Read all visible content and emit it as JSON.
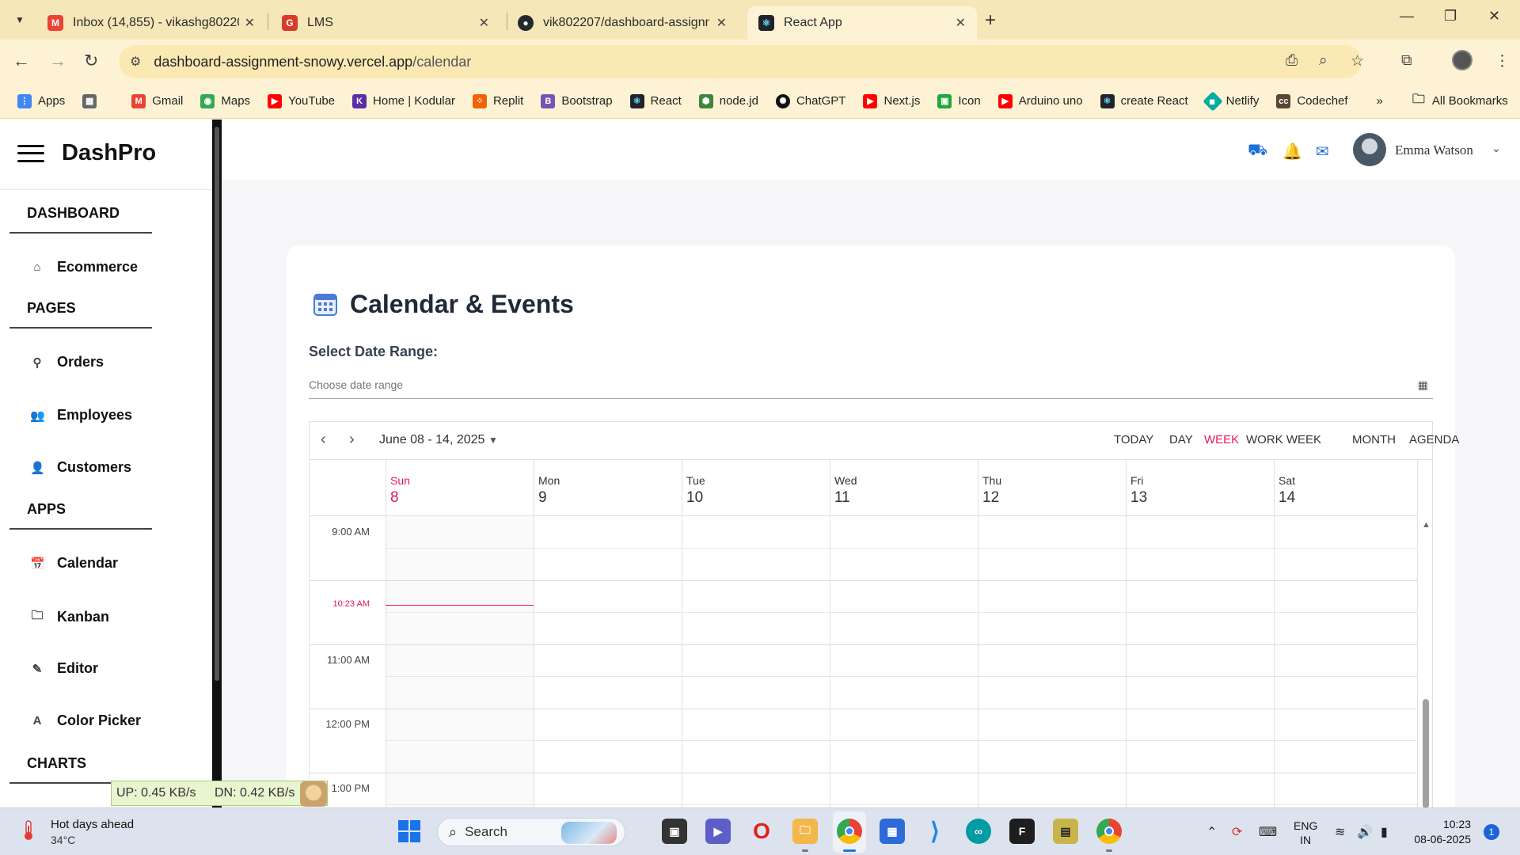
{
  "browser": {
    "tabs": [
      {
        "title": "Inbox (14,855) - vikashg802207",
        "favicon": "gmail-icon"
      },
      {
        "title": "LMS",
        "favicon": "lms-icon"
      },
      {
        "title": "vik802207/dashboard-assignme",
        "favicon": "github-icon"
      },
      {
        "title": "React App",
        "favicon": "react-icon"
      }
    ],
    "url_host": "dashboard-assignment-snowy.vercel.app",
    "url_path": "/calendar",
    "bookmarks": [
      {
        "label": "Apps",
        "color": "#4285f4"
      },
      {
        "label": "Gmail",
        "color": "#ea4335"
      },
      {
        "label": "Maps",
        "color": "#34a853"
      },
      {
        "label": "YouTube",
        "color": "#ff0000"
      },
      {
        "label": "Home | Kodular",
        "color": "#5a2ea6"
      },
      {
        "label": "Replit",
        "color": "#f26207"
      },
      {
        "label": "Bootstrap",
        "color": "#7952b3"
      },
      {
        "label": "React",
        "color": "#20232a"
      },
      {
        "label": "node.jd",
        "color": "#3c873a"
      },
      {
        "label": "ChatGPT",
        "color": "#111111"
      },
      {
        "label": "Next.js",
        "color": "#ff0000"
      },
      {
        "label": "Icon",
        "color": "#1fa83a"
      },
      {
        "label": "Arduino uno",
        "color": "#ff0000"
      },
      {
        "label": "create React",
        "color": "#20232a"
      },
      {
        "label": "Netlify",
        "color": "#00ad9f"
      },
      {
        "label": "Codechef",
        "color": "#5b4638"
      }
    ],
    "all_bookmarks": "All Bookmarks"
  },
  "sidebar": {
    "brand": "DashPro",
    "sections": [
      {
        "title": "DASHBOARD",
        "items": [
          {
            "label": "Ecommerce",
            "icon": "home-icon"
          }
        ]
      },
      {
        "title": "PAGES",
        "items": [
          {
            "label": "Orders",
            "icon": "pin-icon"
          },
          {
            "label": "Employees",
            "icon": "people-icon"
          },
          {
            "label": "Customers",
            "icon": "person-icon"
          }
        ]
      },
      {
        "title": "APPS",
        "items": [
          {
            "label": "Calendar",
            "icon": "calendar-icon"
          },
          {
            "label": "Kanban",
            "icon": "folder-icon"
          },
          {
            "label": "Editor",
            "icon": "pencil-icon"
          },
          {
            "label": "Color Picker",
            "icon": "letter-a-icon"
          }
        ]
      },
      {
        "title": "CHARTS",
        "items": []
      }
    ]
  },
  "header": {
    "user_name": "Emma Watson",
    "accent": "#1e6fd9"
  },
  "page": {
    "title": "Calendar & Events",
    "range_label": "Select Date Range:",
    "range_placeholder": "Choose date range"
  },
  "scheduler": {
    "date_range": "June 08 - 14, 2025",
    "views": [
      "TODAY",
      "DAY",
      "WEEK",
      "WORK WEEK",
      "MONTH",
      "AGENDA"
    ],
    "active_view": "WEEK",
    "accent": "#e3165b",
    "days": [
      {
        "name": "Sun",
        "date": "8"
      },
      {
        "name": "Mon",
        "date": "9"
      },
      {
        "name": "Tue",
        "date": "10"
      },
      {
        "name": "Wed",
        "date": "11"
      },
      {
        "name": "Thu",
        "date": "12"
      },
      {
        "name": "Fri",
        "date": "13"
      },
      {
        "name": "Sat",
        "date": "14"
      }
    ],
    "times": [
      "9:00 AM",
      "11:00 AM",
      "12:00 PM",
      "1:00 PM"
    ],
    "current_time": "10:23 AM"
  },
  "netmeter": {
    "up": "UP: 0.45 KB/s",
    "down": "DN: 0.42 KB/s"
  },
  "taskbar": {
    "weather_title": "Hot days ahead",
    "weather_temp": "34°C",
    "search_placeholder": "Search",
    "lang_top": "ENG",
    "lang_bottom": "IN",
    "time": "10:23",
    "date": "08-06-2025",
    "notifications": "1"
  }
}
